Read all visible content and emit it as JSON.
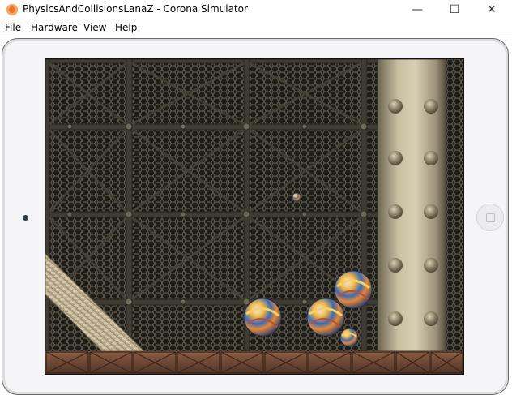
{
  "window": {
    "title": "PhysicsAndCollisionsLanaZ - Corona Simulator",
    "minimize": "—",
    "maximize": "☐",
    "close": "✕"
  },
  "menu": [
    "File",
    "Hardware",
    "View",
    "Help"
  ],
  "colors": {
    "accent": "#f2742a",
    "mesh": "#3a382f",
    "pillar": "#b9ae92",
    "crate": "#6e4836"
  }
}
